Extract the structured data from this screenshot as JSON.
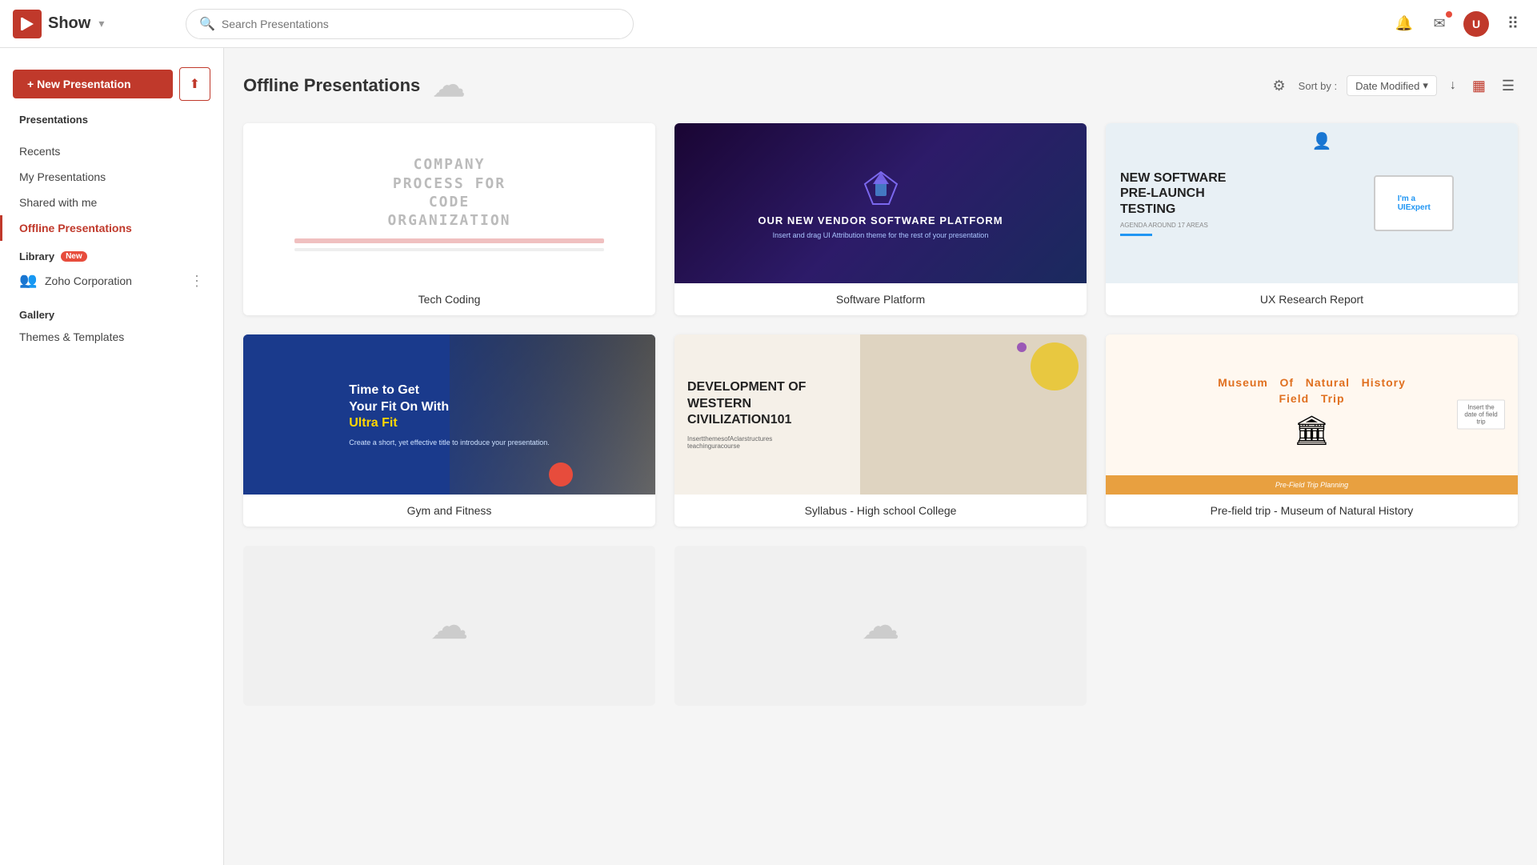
{
  "app": {
    "name": "Show",
    "logo_label": "Show"
  },
  "topnav": {
    "search_placeholder": "Search Presentations",
    "caret": "▾"
  },
  "sidebar": {
    "new_presentation_label": "+ New Presentation",
    "presentations_section": "Presentations",
    "nav_items": [
      {
        "id": "recents",
        "label": "Recents",
        "active": false
      },
      {
        "id": "my-presentations",
        "label": "My Presentations",
        "active": false
      },
      {
        "id": "shared-with-me",
        "label": "Shared with me",
        "active": false
      },
      {
        "id": "offline-presentations",
        "label": "Offline Presentations",
        "active": true
      }
    ],
    "library_section": "Library",
    "library_badge": "New",
    "library_items": [
      {
        "id": "zoho-corp",
        "label": "Zoho Corporation"
      }
    ],
    "gallery_section": "Gallery",
    "gallery_items": [
      {
        "id": "themes-templates",
        "label": "Themes & Templates"
      }
    ]
  },
  "content": {
    "title": "Offline Presentations",
    "sort_label": "Sort by :",
    "sort_option": "Date Modified",
    "presentations": [
      {
        "id": "tech-coding",
        "title": "Tech Coding",
        "type": "tech"
      },
      {
        "id": "software-platform",
        "title": "Software Platform",
        "type": "software"
      },
      {
        "id": "ux-research",
        "title": "UX Research Report",
        "type": "ux"
      },
      {
        "id": "gym-fitness",
        "title": "Gym and Fitness",
        "type": "gym"
      },
      {
        "id": "syllabus",
        "title": "Syllabus - High school College",
        "type": "syllabus"
      },
      {
        "id": "museum",
        "title": "Pre-field trip - Museum of Natural History",
        "type": "museum"
      }
    ]
  },
  "icons": {
    "search": "🔍",
    "notification": "🔔",
    "mail": "✉",
    "grid": "⠿",
    "settings": "⚙",
    "sort_down": "↓",
    "grid_view": "▦",
    "list_view": "☰",
    "upload": "⬆",
    "more": "⋮",
    "library": "👥",
    "cloud_offline": "☁"
  }
}
